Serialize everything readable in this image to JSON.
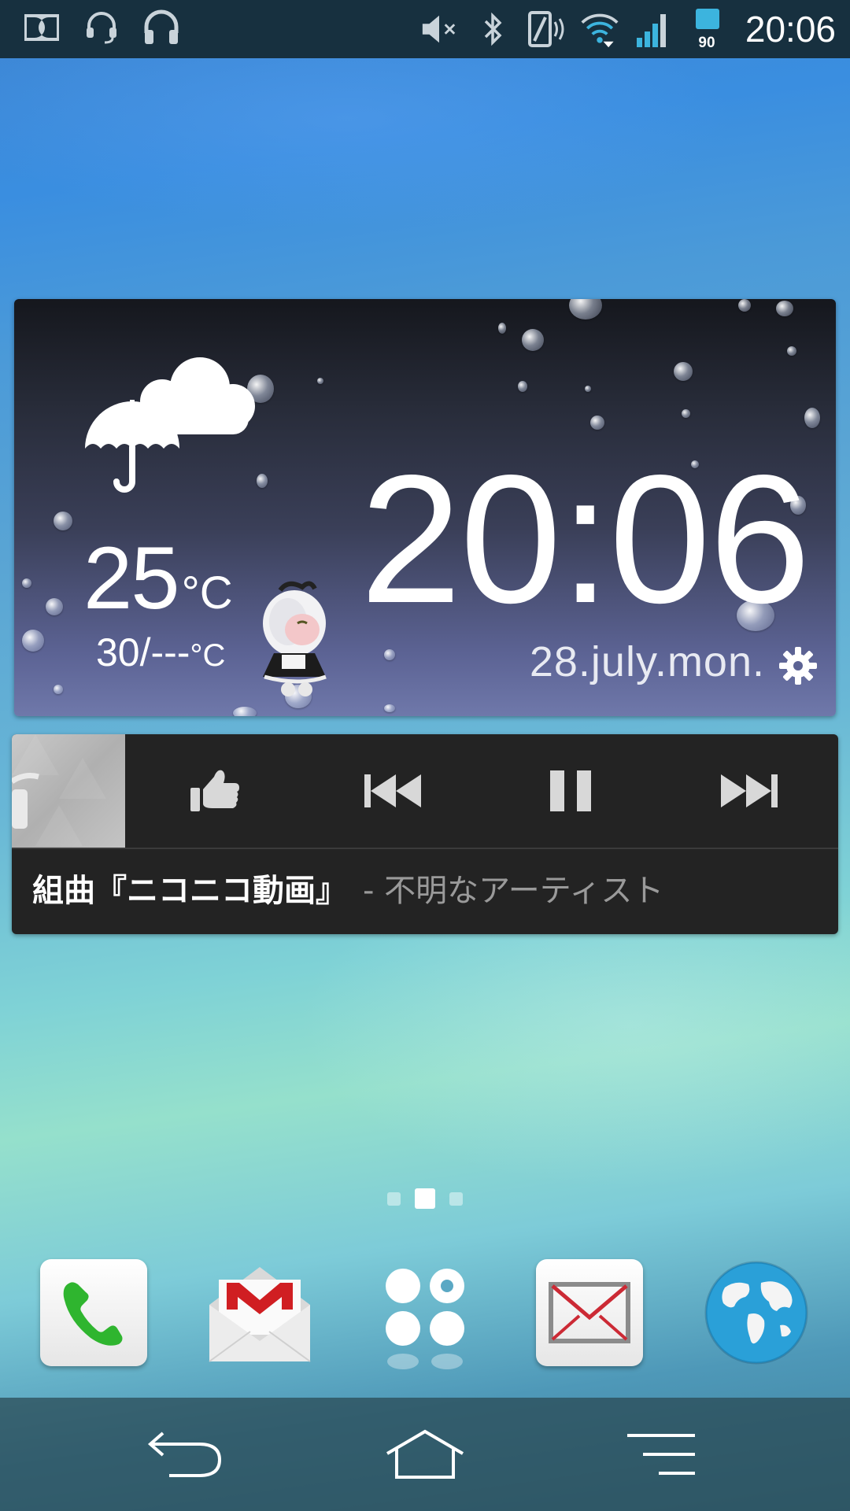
{
  "status_bar": {
    "left_icons": [
      "dolby-icon",
      "headset-icon",
      "headphones-icon"
    ],
    "right_icons": [
      "mute-icon",
      "bluetooth-icon",
      "nfc-icon",
      "wifi-icon",
      "signal-icon"
    ],
    "battery_level": "90",
    "time": "20:06"
  },
  "weather_widget": {
    "condition_icon": "umbrella-cloud-icon",
    "temperature": "25",
    "temperature_unit": "°C",
    "range": "30/---",
    "range_unit": "°C",
    "time": "20:06",
    "date": "28.july.mon."
  },
  "music_widget": {
    "track_title": "組曲『ニコニコ動画』",
    "separator": "-",
    "artist": "不明なアーティスト",
    "controls": [
      "thumbs-up-icon",
      "previous-icon",
      "pause-icon",
      "next-icon"
    ]
  },
  "home": {
    "page_count": 3,
    "active_page": 2
  },
  "dock": {
    "apps": [
      "phone",
      "gmail",
      "app-drawer",
      "email",
      "browser"
    ]
  },
  "nav_bar": [
    "back",
    "home",
    "menu"
  ],
  "colors": {
    "accent": "#34a9d8",
    "phone_green": "#2fb52f",
    "gmail_red": "#d01e22"
  }
}
